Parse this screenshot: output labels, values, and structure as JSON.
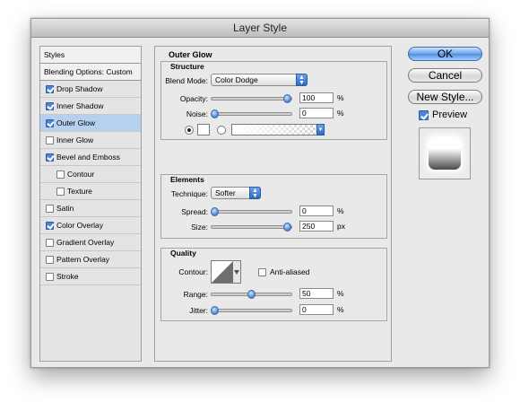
{
  "window": {
    "title": "Layer Style"
  },
  "styles_list": {
    "header": "Styles",
    "blending_options": "Blending Options: Custom",
    "items": [
      {
        "label": "Drop Shadow",
        "checked": true,
        "indent": false,
        "selected": false
      },
      {
        "label": "Inner Shadow",
        "checked": true,
        "indent": false,
        "selected": false
      },
      {
        "label": "Outer Glow",
        "checked": true,
        "indent": false,
        "selected": true
      },
      {
        "label": "Inner Glow",
        "checked": false,
        "indent": false,
        "selected": false
      },
      {
        "label": "Bevel and Emboss",
        "checked": true,
        "indent": false,
        "selected": false
      },
      {
        "label": "Contour",
        "checked": false,
        "indent": true,
        "selected": false
      },
      {
        "label": "Texture",
        "checked": false,
        "indent": true,
        "selected": false
      },
      {
        "label": "Satin",
        "checked": false,
        "indent": false,
        "selected": false
      },
      {
        "label": "Color Overlay",
        "checked": true,
        "indent": false,
        "selected": false
      },
      {
        "label": "Gradient Overlay",
        "checked": false,
        "indent": false,
        "selected": false
      },
      {
        "label": "Pattern Overlay",
        "checked": false,
        "indent": false,
        "selected": false
      },
      {
        "label": "Stroke",
        "checked": false,
        "indent": false,
        "selected": false
      }
    ]
  },
  "outer_glow": {
    "title": "Outer Glow",
    "structure": {
      "title": "Structure",
      "blend_mode_label": "Blend Mode:",
      "blend_mode_value": "Color Dodge",
      "opacity_label": "Opacity:",
      "opacity_value": "100",
      "opacity_fraction": 1.0,
      "noise_label": "Noise:",
      "noise_value": "0",
      "noise_fraction": 0.0,
      "percent": "%"
    },
    "elements": {
      "title": "Elements",
      "technique_label": "Technique:",
      "technique_value": "Softer",
      "spread_label": "Spread:",
      "spread_value": "0",
      "spread_fraction": 0.0,
      "size_label": "Size:",
      "size_value": "250",
      "size_fraction": 1.0,
      "percent": "%",
      "px": "px"
    },
    "quality": {
      "title": "Quality",
      "contour_label": "Contour:",
      "anti_aliased_label": "Anti-aliased",
      "anti_aliased_checked": false,
      "range_label": "Range:",
      "range_value": "50",
      "range_fraction": 0.5,
      "jitter_label": "Jitter:",
      "jitter_value": "0",
      "jitter_fraction": 0.0,
      "percent": "%"
    }
  },
  "buttons": {
    "ok": "OK",
    "cancel": "Cancel",
    "new_style": "New Style..."
  },
  "preview": {
    "label": "Preview",
    "checked": true
  },
  "colors": {
    "accent": "#4d86d6",
    "selected_row": "#b5d1ef"
  }
}
